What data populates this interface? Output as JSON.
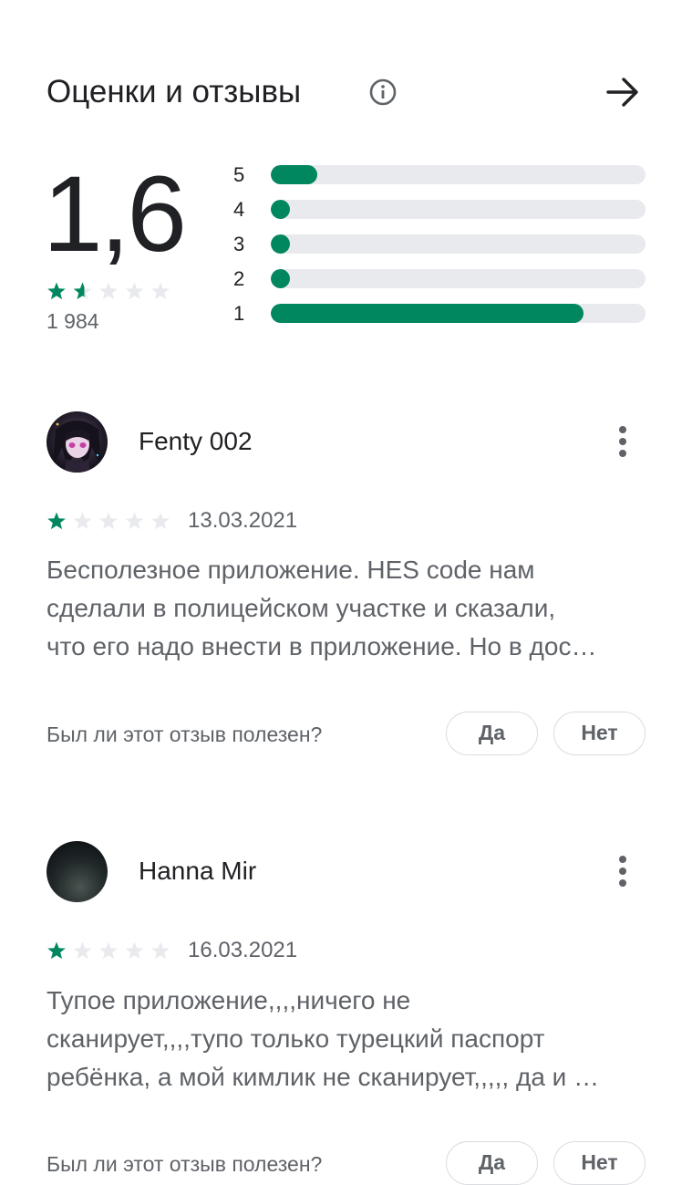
{
  "header": {
    "title": "Оценки и отзывы",
    "info_icon": "info-circle-icon",
    "arrow_icon": "arrow-right-icon"
  },
  "summary": {
    "rating": "1,6",
    "stars_filled": 1.6,
    "star_count_total": 5,
    "review_count": "1 984",
    "bars": [
      {
        "label": "5",
        "fraction": 0.125
      },
      {
        "label": "4",
        "fraction": 0.05
      },
      {
        "label": "3",
        "fraction": 0.05
      },
      {
        "label": "2",
        "fraction": 0.05
      },
      {
        "label": "1",
        "fraction": 0.835
      }
    ]
  },
  "colors": {
    "accent": "#01875f",
    "track": "#e8eaed",
    "text_primary": "#202124",
    "text_secondary": "#5f6368",
    "star_empty": "#e8eaed"
  },
  "reviews": [
    {
      "author": "Fenty 002",
      "stars": 1,
      "date": "13.03.2021",
      "lines": [
        "Бесполезное приложение. HES code нам",
        "сделали в полицейском участке и сказали,",
        "что его надо внести в приложение. Но в дос…"
      ],
      "helpful_question": "Был ли этот отзыв полезен?",
      "yes_label": "Да",
      "no_label": "Нет"
    },
    {
      "author": "Hanna Mir",
      "stars": 1,
      "date": "16.03.2021",
      "lines": [
        "Тупое приложение,,,,ничего не",
        "сканирует,,,,тупо только турецкий паспорт",
        "ребёнка, а мой кимлик не сканирует,,,,, да и …"
      ],
      "helpful_question": "Был ли этот отзыв полезен?",
      "yes_label": "Да",
      "no_label": "Нет"
    }
  ]
}
